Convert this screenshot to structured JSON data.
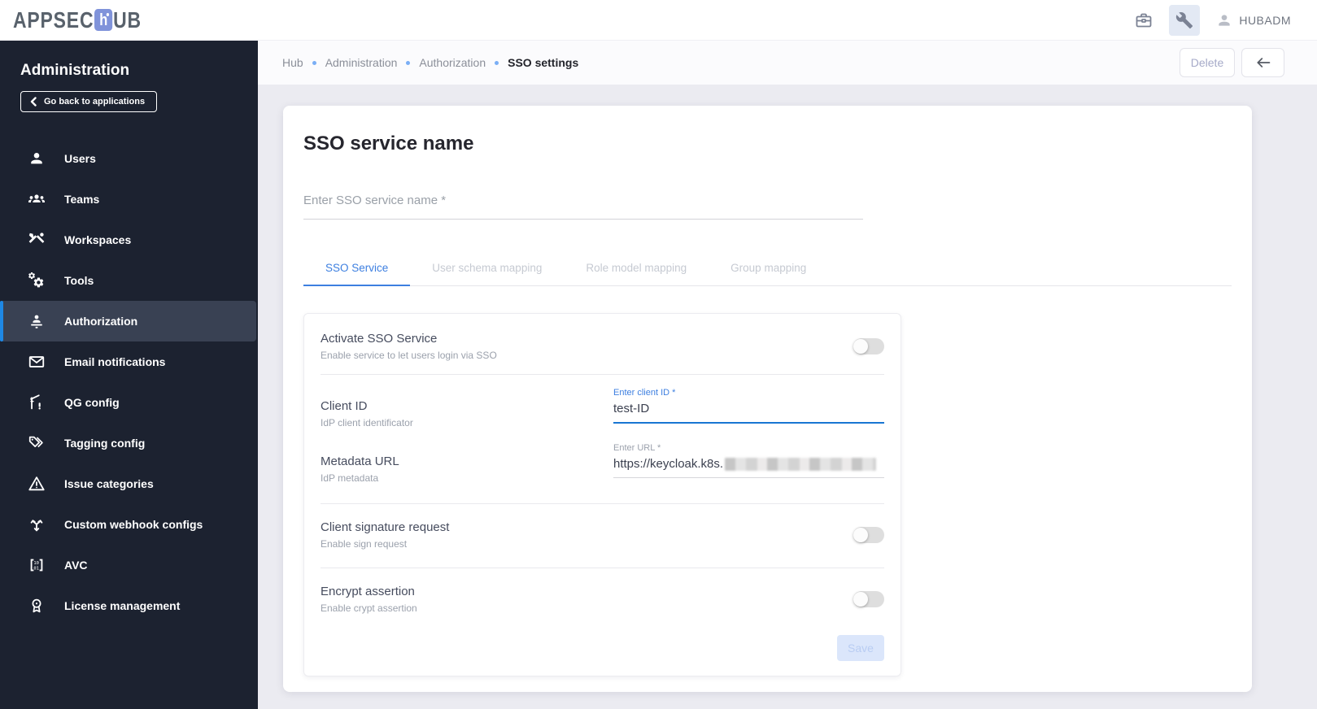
{
  "topbar": {
    "logo": {
      "part1": "APPSEC",
      "part2": "h",
      "part3": "UB"
    },
    "user_label": "HUBADM"
  },
  "sidebar": {
    "title": "Administration",
    "back_button_label": "Go back to applications",
    "items": [
      {
        "label": "Users",
        "icon": "person-icon",
        "selected": false
      },
      {
        "label": "Teams",
        "icon": "groups-icon",
        "selected": false
      },
      {
        "label": "Workspaces",
        "icon": "construction-icon",
        "selected": false
      },
      {
        "label": "Tools",
        "icon": "gears-icon",
        "selected": false
      },
      {
        "label": "Authorization",
        "icon": "assignment-person-icon",
        "selected": true
      },
      {
        "label": "Email notifications",
        "icon": "mail-icon",
        "selected": false
      },
      {
        "label": "QG config",
        "icon": "gate-icon",
        "selected": false
      },
      {
        "label": "Tagging config",
        "icon": "tags-icon",
        "selected": false
      },
      {
        "label": "Issue categories",
        "icon": "warning-triangle-icon",
        "selected": false
      },
      {
        "label": "Custom webhook configs",
        "icon": "split-arrows-icon",
        "selected": false
      },
      {
        "label": "AVC",
        "icon": "binary-brackets-icon",
        "selected": false
      },
      {
        "label": "License management",
        "icon": "medal-icon",
        "selected": false
      }
    ]
  },
  "breadcrumb": {
    "items": [
      "Hub",
      "Administration",
      "Authorization"
    ],
    "current": "SSO settings"
  },
  "header_actions": {
    "delete_label": "Delete"
  },
  "main": {
    "title": "SSO service name",
    "name_input": {
      "placeholder": "Enter SSO service name *",
      "value": ""
    },
    "tabs": [
      {
        "label": "SSO Service",
        "active": true
      },
      {
        "label": "User schema mapping",
        "active": false
      },
      {
        "label": "Role model mapping",
        "active": false
      },
      {
        "label": "Group mapping",
        "active": false
      }
    ],
    "form": {
      "activate": {
        "title": "Activate SSO Service",
        "subtitle": "Enable service to let users login via SSO",
        "enabled": false
      },
      "client_id": {
        "title": "Client ID",
        "subtitle": "IdP client identificator",
        "input_label": "Enter client ID *",
        "value": "test-ID"
      },
      "metadata_url": {
        "title": "Metadata URL",
        "subtitle": "IdP metadata",
        "input_label": "Enter URL *",
        "value": "https://keycloak.k8s.",
        "value_suffix_redacted": true
      },
      "signature": {
        "title": "Client signature request",
        "subtitle": "Enable sign request",
        "enabled": false
      },
      "encrypt": {
        "title": "Encrypt assertion",
        "subtitle": "Enable crypt assertion",
        "enabled": false
      },
      "save_label": "Save"
    }
  },
  "ui_colors": {
    "accent_blue": "#3d7fe0",
    "focus_underline_blue": "#1976d2",
    "sidebar_bg": "#1c2230",
    "sidebar_selected_bg": "#394153",
    "sidebar_selected_border": "#1e88e5",
    "page_bg": "#ebebf1",
    "logo_square": "#8093da",
    "save_disabled_bg": "#dbe6fb",
    "save_disabled_text": "#b9cdf3",
    "breadcrumb_dot": "#7aaef5"
  }
}
